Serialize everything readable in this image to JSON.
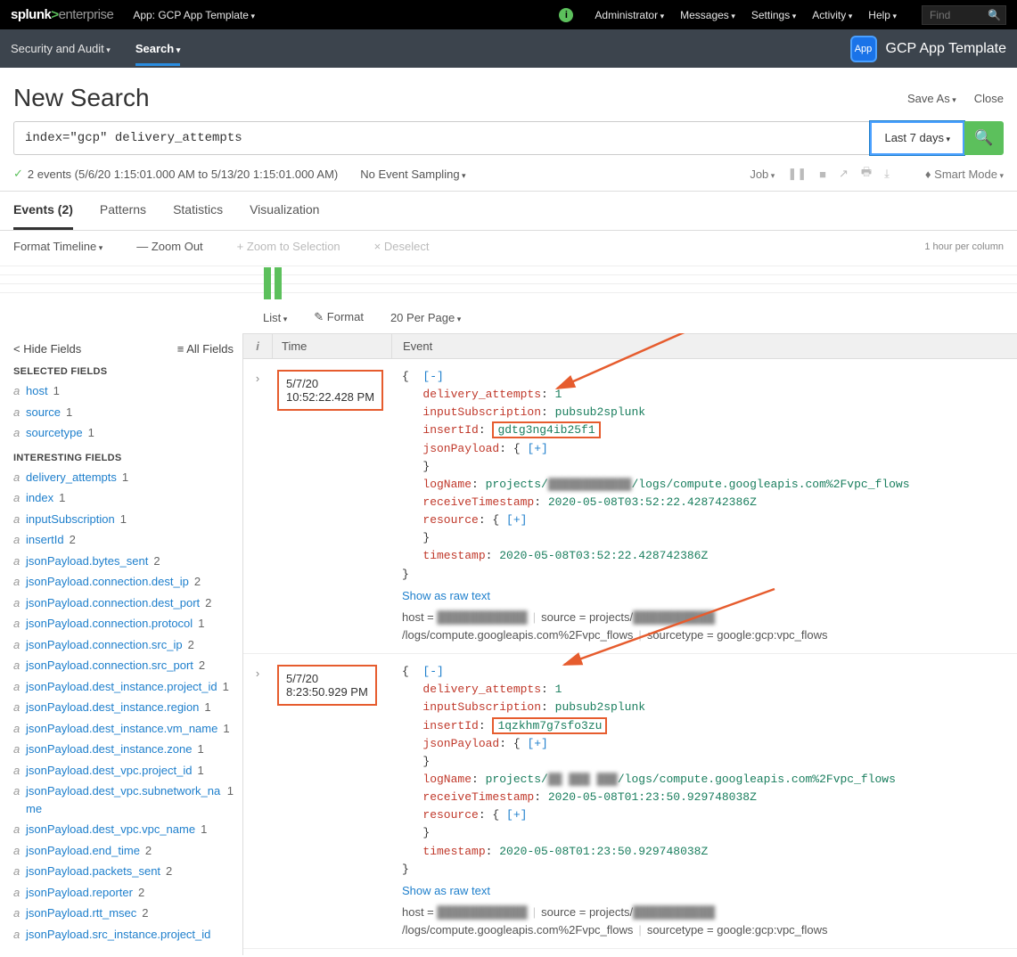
{
  "topbar": {
    "logo_a": "splunk",
    "logo_b": "enterprise",
    "app_context": "App: GCP App Template",
    "menus": [
      "Administrator",
      "Messages",
      "Settings",
      "Activity",
      "Help"
    ],
    "find_placeholder": "Find"
  },
  "navbar": {
    "items": [
      {
        "label": "Security and Audit",
        "active": false,
        "caret": true
      },
      {
        "label": "Search",
        "active": true,
        "caret": true
      }
    ],
    "app_chip": "App",
    "app_title": "GCP App Template"
  },
  "page": {
    "title": "New Search",
    "save_as": "Save As",
    "close": "Close"
  },
  "search": {
    "query": "index=\"gcp\" delivery_attempts",
    "time_range": "Last 7 days"
  },
  "status": {
    "text": "2 events (5/6/20 1:15:01.000 AM to 5/13/20 1:15:01.000 AM)",
    "sampling": "No Event Sampling",
    "job": "Job",
    "smart": "Smart Mode"
  },
  "tabs": {
    "events": "Events (2)",
    "patterns": "Patterns",
    "statistics": "Statistics",
    "visualization": "Visualization"
  },
  "timeline": {
    "format": "Format Timeline",
    "zoom_out": "Zoom Out",
    "zoom_sel": "Zoom to Selection",
    "deselect": "Deselect",
    "scale": "1 hour per column"
  },
  "view": {
    "list": "List",
    "format": "Format",
    "per_page": "20 Per Page"
  },
  "sidebar": {
    "hide": "Hide Fields",
    "all": "All Fields",
    "selected_title": "SELECTED FIELDS",
    "interesting_title": "INTERESTING FIELDS",
    "selected": [
      {
        "t": "a",
        "n": "host",
        "c": "1"
      },
      {
        "t": "a",
        "n": "source",
        "c": "1"
      },
      {
        "t": "a",
        "n": "sourcetype",
        "c": "1"
      }
    ],
    "interesting": [
      {
        "t": "a",
        "n": "delivery_attempts",
        "c": "1"
      },
      {
        "t": "a",
        "n": "index",
        "c": "1"
      },
      {
        "t": "a",
        "n": "inputSubscription",
        "c": "1"
      },
      {
        "t": "a",
        "n": "insertId",
        "c": "2"
      },
      {
        "t": "a",
        "n": "jsonPayload.bytes_sent",
        "c": "2"
      },
      {
        "t": "a",
        "n": "jsonPayload.connection.dest_ip",
        "c": "2"
      },
      {
        "t": "a",
        "n": "jsonPayload.connection.dest_port",
        "c": "2"
      },
      {
        "t": "a",
        "n": "jsonPayload.connection.protocol",
        "c": "1"
      },
      {
        "t": "a",
        "n": "jsonPayload.connection.src_ip",
        "c": "2"
      },
      {
        "t": "a",
        "n": "jsonPayload.connection.src_port",
        "c": "2"
      },
      {
        "t": "a",
        "n": "jsonPayload.dest_instance.project_id",
        "c": "1"
      },
      {
        "t": "a",
        "n": "jsonPayload.dest_instance.region",
        "c": "1"
      },
      {
        "t": "a",
        "n": "jsonPayload.dest_instance.vm_name",
        "c": "1"
      },
      {
        "t": "a",
        "n": "jsonPayload.dest_instance.zone",
        "c": "1"
      },
      {
        "t": "a",
        "n": "jsonPayload.dest_vpc.project_id",
        "c": "1"
      },
      {
        "t": "a",
        "n": "jsonPayload.dest_vpc.subnetwork_name",
        "c": "1"
      },
      {
        "t": "a",
        "n": "jsonPayload.dest_vpc.vpc_name",
        "c": "1"
      },
      {
        "t": "a",
        "n": "jsonPayload.end_time",
        "c": "2"
      },
      {
        "t": "a",
        "n": "jsonPayload.packets_sent",
        "c": "2"
      },
      {
        "t": "a",
        "n": "jsonPayload.reporter",
        "c": "2"
      },
      {
        "t": "a",
        "n": "jsonPayload.rtt_msec",
        "c": "2"
      },
      {
        "t": "a",
        "n": "jsonPayload.src_instance.project_id",
        "c": ""
      }
    ]
  },
  "table": {
    "head_info": "i",
    "head_time": "Time",
    "head_event": "Event",
    "rows": [
      {
        "date": "5/7/20",
        "time": "10:52:22.428 PM",
        "delivery_attempts": "1",
        "inputSubscription": "pubsub2splunk",
        "insertId": "gdtg3ng4ib25f1",
        "logName_a": "projects/",
        "logName_blur": "████████████",
        "logName_b": "/logs/compute.googleapis.com%2Fvpc_flows",
        "receiveTimestamp": "2020-05-08T03:52:22.428742386Z",
        "timestamp": "2020-05-08T03:52:22.428742386Z",
        "raw": "Show as raw text",
        "host_blur": "███████████",
        "source_a": "projects/",
        "source_blur": "██████████",
        "source_b": "/logs/compute.googleapis.com%2Fvpc_flows",
        "sourcetype": "google:gcp:vpc_flows"
      },
      {
        "date": "5/7/20",
        "time": "8:23:50.929 PM",
        "delivery_attempts": "1",
        "inputSubscription": "pubsub2splunk",
        "insertId": "1qzkhm7g7sfo3zu",
        "logName_a": "projects/",
        "logName_blur": "██  ███  ███",
        "logName_b": "/logs/compute.googleapis.com%2Fvpc_flows",
        "receiveTimestamp": "2020-05-08T01:23:50.929748038Z",
        "timestamp": "2020-05-08T01:23:50.929748038Z",
        "raw": "Show as raw text",
        "host_blur": "███████████",
        "source_a": "projects/",
        "source_blur": "██████████",
        "source_b": "/logs/compute.googleapis.com%2Fvpc_flows",
        "sourcetype": "google:gcp:vpc_flows"
      }
    ]
  },
  "labels": {
    "host": "host = ",
    "source": "source = ",
    "sourcetype": "sourcetype = ",
    "jk_delivery": "delivery_attempts",
    "jk_inputSub": "inputSubscription",
    "jk_insertId": "insertId",
    "jk_jsonPayload": "jsonPayload",
    "jk_logName": "logName",
    "jk_receiveTs": "receiveTimestamp",
    "jk_resource": "resource",
    "jk_timestamp": "timestamp",
    "collapse": "[-]",
    "expand": "[+]"
  }
}
